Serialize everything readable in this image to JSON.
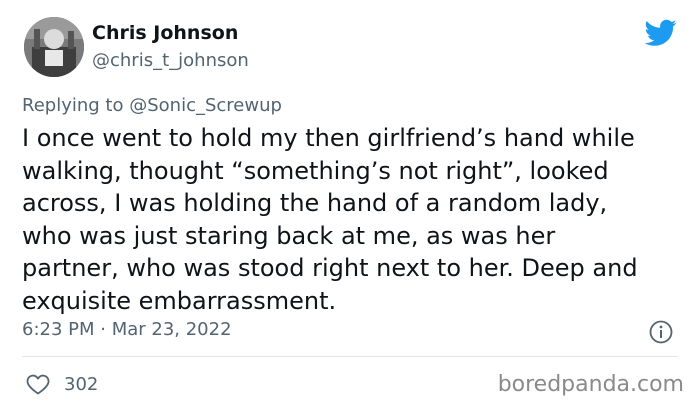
{
  "author": {
    "display_name": "Chris Johnson",
    "handle": "@chris_t_johnson"
  },
  "reply": {
    "prefix": "Replying to",
    "target": "@Sonic_Screwup"
  },
  "tweet": {
    "lines": [
      "I once went to hold my then girlfriend’s hand while",
      "walking, thought “something’s not right”, looked",
      "across, I was holding the hand of a random lady,",
      "who was just staring back at me, as was her",
      "partner, who was stood right next to her. Deep and",
      "exquisite embarrassment."
    ],
    "timestamp": "6:23 PM · Mar 23, 2022"
  },
  "stats": {
    "likes": "302"
  },
  "watermark": "boredpanda.com",
  "colors": {
    "text": "#0f1419",
    "muted": "#536471",
    "twitter_blue": "#1d9bf0"
  },
  "icons": {
    "logo": "twitter-bird-icon",
    "info": "info-icon",
    "like": "heart-icon"
  }
}
